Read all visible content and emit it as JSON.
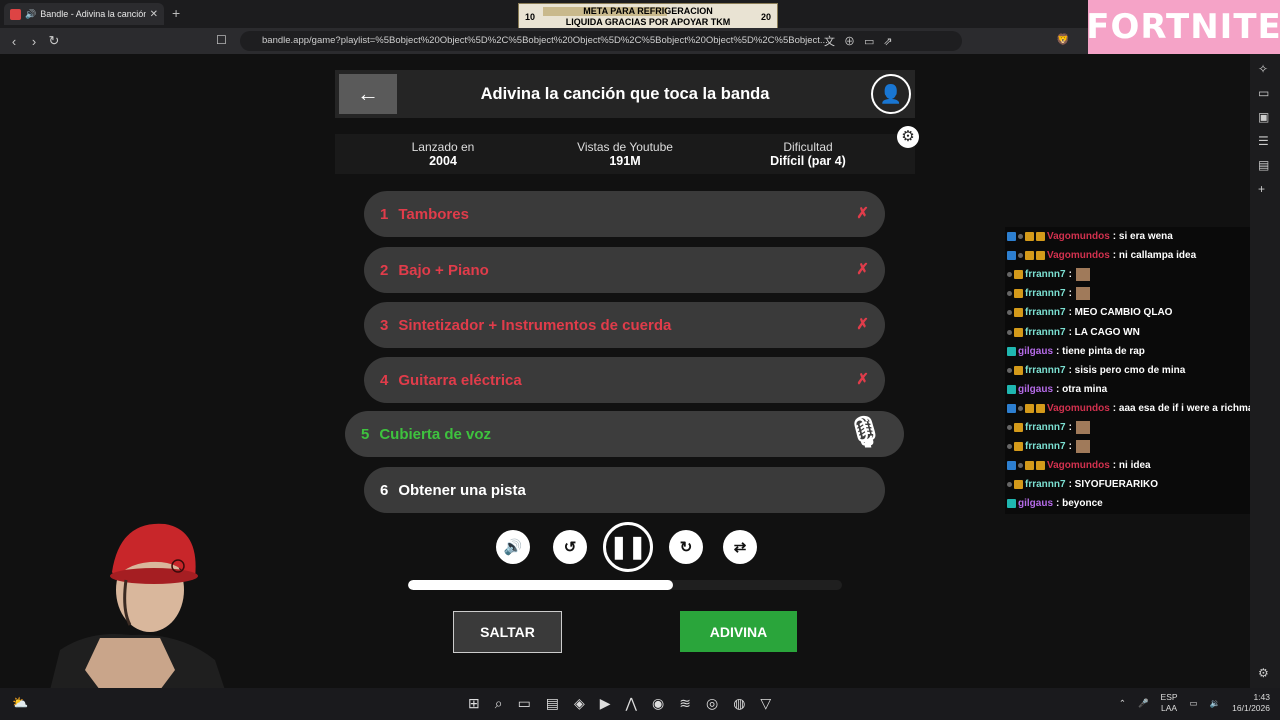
{
  "browser": {
    "tab_title": "Bandle - Adivina la canción, u",
    "url": "bandle.app/game?playlist=%5Bobject%20Object%5D%2C%5Bobject%20Object%5D%2C%5Bobject%20Object%5D%2C%5Bobject..."
  },
  "overlay": {
    "goal_left": "10",
    "goal_right": "20",
    "goal_line1": "META PARA REFRIGERACION",
    "goal_line2": "LIQUIDA GRACIAS POR APOYAR TKM",
    "goal_progress": 0.48,
    "banner": "FORTNITE"
  },
  "game": {
    "title": "Adivina la canción que toca la banda",
    "stats": [
      {
        "label": "Lanzado en",
        "value": "2004"
      },
      {
        "label": "Vistas de Youtube",
        "value": "191M"
      },
      {
        "label": "Dificultad",
        "value": "Difícil (par 4)"
      }
    ],
    "hints": [
      {
        "num": "1",
        "label": "Tambores",
        "state": "wrong"
      },
      {
        "num": "2",
        "label": "Bajo + Piano",
        "state": "wrong"
      },
      {
        "num": "3",
        "label": "Sintetizador + Instrumentos de cuerda",
        "state": "wrong"
      },
      {
        "num": "4",
        "label": "Guitarra eléctrica",
        "state": "wrong"
      },
      {
        "num": "5",
        "label": "Cubierta de voz",
        "state": "active"
      },
      {
        "num": "6",
        "label": "Obtener una pista",
        "state": "plain"
      }
    ],
    "wrong_mark": "✗",
    "playback_progress": 0.61,
    "skip_label": "SALTAR",
    "guess_label": "ADIVINA"
  },
  "chat": [
    {
      "user": "Vagomundos",
      "color": "red",
      "badges": [
        "blue",
        "grey",
        "gold",
        "gold"
      ],
      "text": ": si era wena"
    },
    {
      "user": "Vagomundos",
      "color": "red",
      "badges": [
        "blue",
        "grey",
        "gold",
        "gold"
      ],
      "text": ": ni callampa idea"
    },
    {
      "user": "frrannn7",
      "color": "cyan",
      "badges": [
        "grey",
        "gold"
      ],
      "text": ":",
      "emote": true
    },
    {
      "user": "frrannn7",
      "color": "cyan",
      "badges": [
        "grey",
        "gold"
      ],
      "text": ":",
      "emote": true
    },
    {
      "user": "frrannn7",
      "color": "cyan",
      "badges": [
        "grey",
        "gold"
      ],
      "text": ": MEO CAMBIO QLAO"
    },
    {
      "user": "frrannn7",
      "color": "cyan",
      "badges": [
        "grey",
        "gold"
      ],
      "text": ": LA CAGO WN"
    },
    {
      "user": "gilgaus",
      "color": "purple",
      "badges": [
        "teal"
      ],
      "text": ": tiene pinta de rap"
    },
    {
      "user": "frrannn7",
      "color": "cyan",
      "badges": [
        "grey",
        "gold"
      ],
      "text": ": sisis pero cmo de mina"
    },
    {
      "user": "gilgaus",
      "color": "purple",
      "badges": [
        "teal"
      ],
      "text": ": otra mina"
    },
    {
      "user": "Vagomundos",
      "color": "red",
      "badges": [
        "blue",
        "grey",
        "gold",
        "gold"
      ],
      "text": ": aaa esa de if i were a richman"
    },
    {
      "user": "frrannn7",
      "color": "cyan",
      "badges": [
        "grey",
        "gold"
      ],
      "text": ":",
      "emote": true
    },
    {
      "user": "frrannn7",
      "color": "cyan",
      "badges": [
        "grey",
        "gold"
      ],
      "text": ":",
      "emote": true
    },
    {
      "user": "Vagomundos",
      "color": "red",
      "badges": [
        "blue",
        "grey",
        "gold",
        "gold"
      ],
      "text": ": ni idea"
    },
    {
      "user": "frrannn7",
      "color": "cyan",
      "badges": [
        "grey",
        "gold"
      ],
      "text": ": SIYOFUERARIKO"
    },
    {
      "user": "gilgaus",
      "color": "purple",
      "badges": [
        "teal"
      ],
      "text": ": beyonce"
    }
  ],
  "taskbar": {
    "lang_top": "ESP",
    "lang_bottom": "LAA",
    "time": "1:43",
    "date": "16/1/2026"
  }
}
